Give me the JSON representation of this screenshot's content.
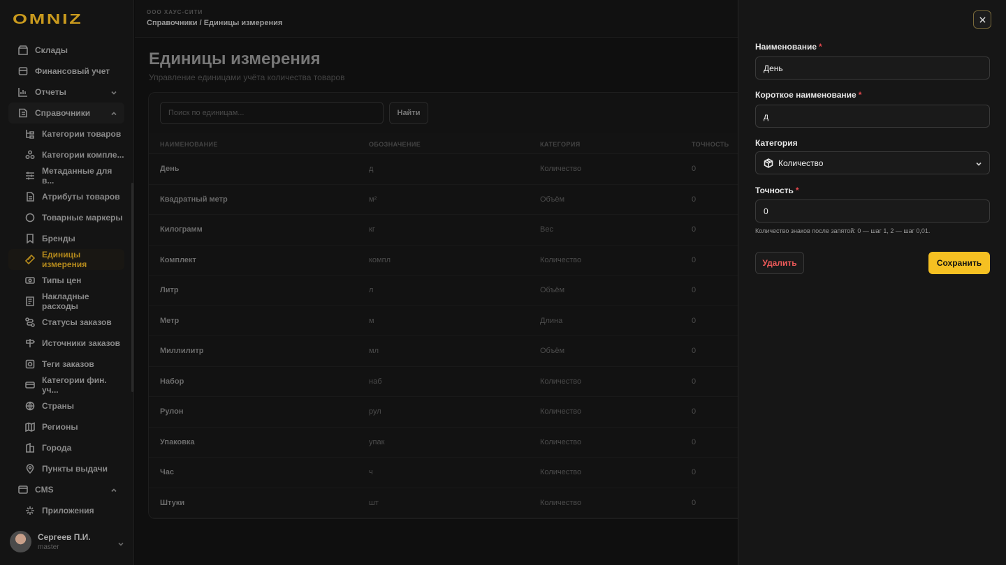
{
  "brand": {
    "logo_text": "OMNIZ",
    "accent": "#f5c022"
  },
  "header": {
    "org": "ООО ХАУС-СИТИ",
    "breadcrumb": "Справочники / Единицы измерения"
  },
  "sidebar": {
    "items": [
      {
        "label": "Склады",
        "icon": "warehouse-icon"
      },
      {
        "label": "Финансовый учет",
        "icon": "wallet-icon"
      },
      {
        "label": "Отчеты",
        "icon": "chart-icon"
      },
      {
        "label": "Справочники",
        "icon": "book-icon"
      },
      {
        "label": "CMS",
        "icon": "window-icon"
      }
    ],
    "sub_items": [
      {
        "label": "Категории товаров",
        "icon": "category-icon"
      },
      {
        "label": "Категории компле...",
        "icon": "bundle-icon"
      },
      {
        "label": "Метаданные для в...",
        "icon": "sliders-icon"
      },
      {
        "label": "Атрибуты товаров",
        "icon": "document-icon"
      },
      {
        "label": "Товарные маркеры",
        "icon": "circle-icon"
      },
      {
        "label": "Бренды",
        "icon": "bookmark-icon"
      },
      {
        "label": "Единицы измерения",
        "icon": "ruler-icon"
      },
      {
        "label": "Типы цен",
        "icon": "price-icon"
      },
      {
        "label": "Накладные расходы",
        "icon": "invoice-icon"
      },
      {
        "label": "Статусы заказов",
        "icon": "route-icon"
      },
      {
        "label": "Источники заказов",
        "icon": "signpost-icon"
      },
      {
        "label": "Теги заказов",
        "icon": "tag-icon"
      },
      {
        "label": "Категории фин. уч...",
        "icon": "card-icon"
      },
      {
        "label": "Страны",
        "icon": "globe-icon"
      },
      {
        "label": "Регионы",
        "icon": "map-icon"
      },
      {
        "label": "Города",
        "icon": "building-icon"
      },
      {
        "label": "Пункты выдачи",
        "icon": "pin-icon"
      }
    ],
    "cms_sub": {
      "label": "Приложения",
      "icon": "apps-icon"
    },
    "user": {
      "name": "Сергеев П.И.",
      "role": "master"
    }
  },
  "main": {
    "title": "Единицы измерения",
    "subtitle": "Управление единицами учёта количества товаров",
    "search_placeholder": "Поиск по единицам...",
    "search_button": "Найти",
    "columns": [
      "НАИМЕНОВАНИЕ",
      "ОБОЗНАЧЕНИЕ",
      "КАТЕГОРИЯ",
      "ТОЧНОСТЬ"
    ],
    "rows": [
      [
        "День",
        "д",
        "Количество",
        "0"
      ],
      [
        "Квадратный метр",
        "м²",
        "Объём",
        "0"
      ],
      [
        "Килограмм",
        "кг",
        "Вес",
        "0"
      ],
      [
        "Комплект",
        "компл",
        "Количество",
        "0"
      ],
      [
        "Литр",
        "л",
        "Объём",
        "0"
      ],
      [
        "Метр",
        "м",
        "Длина",
        "0"
      ],
      [
        "Миллилитр",
        "мл",
        "Объём",
        "0"
      ],
      [
        "Набор",
        "наб",
        "Количество",
        "0"
      ],
      [
        "Рулон",
        "рул",
        "Количество",
        "0"
      ],
      [
        "Упаковка",
        "упак",
        "Количество",
        "0"
      ],
      [
        "Час",
        "ч",
        "Количество",
        "0"
      ],
      [
        "Штуки",
        "шт",
        "Количество",
        "0"
      ]
    ]
  },
  "drawer": {
    "name_label": "Наименование",
    "name_value": "День",
    "short_label": "Короткое наименование",
    "short_value": "д",
    "category_label": "Категория",
    "category_value": "Количество",
    "category_icon": "package-icon",
    "precision_label": "Точность",
    "precision_value": "0",
    "precision_hint": "Количество знаков после запятой: 0 — шаг 1, 2 — шаг 0,01.",
    "required_mark": "*",
    "delete_label": "Удалить",
    "save_label": "Сохранить"
  }
}
